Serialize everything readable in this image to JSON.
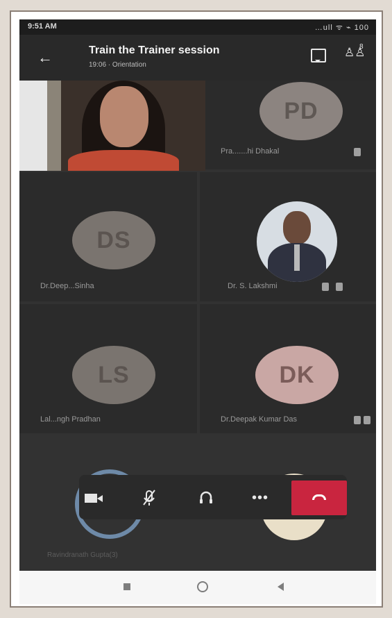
{
  "status_bar": {
    "time": "9:51 AM",
    "icons": "…ull ᯤ ⌁ 100"
  },
  "header": {
    "title": "Train the Trainer session",
    "subtitle": "19:06 · Orientation",
    "people_count": "8"
  },
  "participants": [
    {
      "name": "",
      "type": "self-video"
    },
    {
      "initials": "PD",
      "name": "Pra.......hi Dhakal",
      "muted": true
    },
    {
      "initials": "DS",
      "name": "Dr.Deep...Sinha",
      "muted": true
    },
    {
      "initials": "",
      "name": "Dr. S. Lakshmi",
      "muted": true,
      "type": "photo"
    },
    {
      "initials": "LS",
      "name": "Lal...ngh Pradhan",
      "muted": true
    },
    {
      "initials": "DK",
      "name": "Dr.Deepak Kumar Das",
      "muted": true
    }
  ],
  "controls": {
    "more_label": "•••",
    "caption": "Ravindranath Gupta(3)"
  }
}
